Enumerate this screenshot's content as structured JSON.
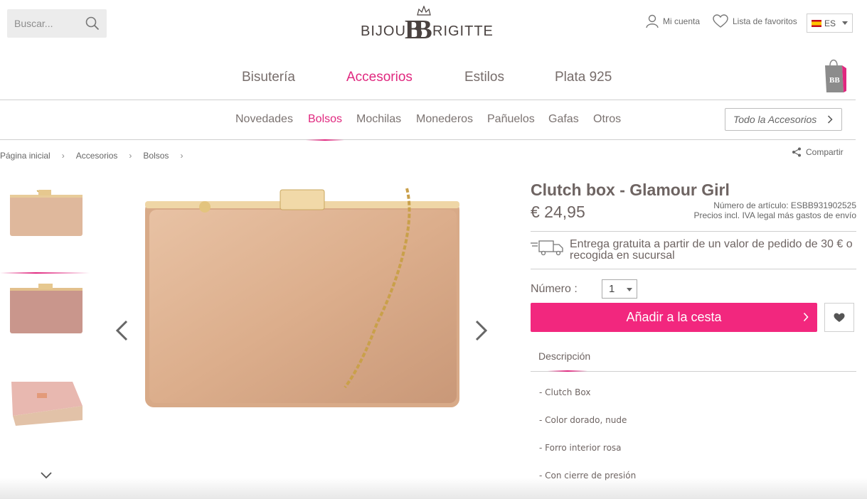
{
  "header": {
    "search_placeholder": "Buscar...",
    "logo_left": "BIJOU",
    "logo_mark": "BB",
    "logo_right": "RIGITTE",
    "account_label": "Mi cuenta",
    "favorites_label": "Lista de favoritos",
    "language": "ES"
  },
  "main_nav": [
    {
      "label": "Bisutería",
      "active": false
    },
    {
      "label": "Accesorios",
      "active": true
    },
    {
      "label": "Estilos",
      "active": false
    },
    {
      "label": "Plata 925",
      "active": false
    }
  ],
  "sub_nav": [
    {
      "label": "Novedades",
      "active": false
    },
    {
      "label": "Bolsos",
      "active": true
    },
    {
      "label": "Mochilas",
      "active": false
    },
    {
      "label": "Monederos",
      "active": false
    },
    {
      "label": "Pañuelos",
      "active": false
    },
    {
      "label": "Gafas",
      "active": false
    },
    {
      "label": "Otros",
      "active": false
    }
  ],
  "all_button": "Todo la Accesorios",
  "breadcrumb": [
    "Página inicial",
    "Accesorios",
    "Bolsos"
  ],
  "share_label": "Compartir",
  "product": {
    "title": "Clutch box - Glamour Girl",
    "price": "€ 24,95",
    "article_number": "Número de artículo: ESBB931902525",
    "vat_note": "Precios incl. IVA legal más gastos de envío",
    "delivery": "Entrega gratuita a partir de un valor de pedido de 30 € o recogida en sucursal",
    "quantity_label": "Número :",
    "quantity_value": "1",
    "add_to_cart": "Añadir a la cesta",
    "tab_label": "Descripción",
    "description": [
      "- Clutch Box",
      "- Color dorado, nude",
      "- Forro interior rosa",
      "- Con cierre de presión"
    ]
  },
  "colors": {
    "accent": "#f2277e",
    "active_nav": "#e0287f",
    "text": "#6e6462"
  }
}
